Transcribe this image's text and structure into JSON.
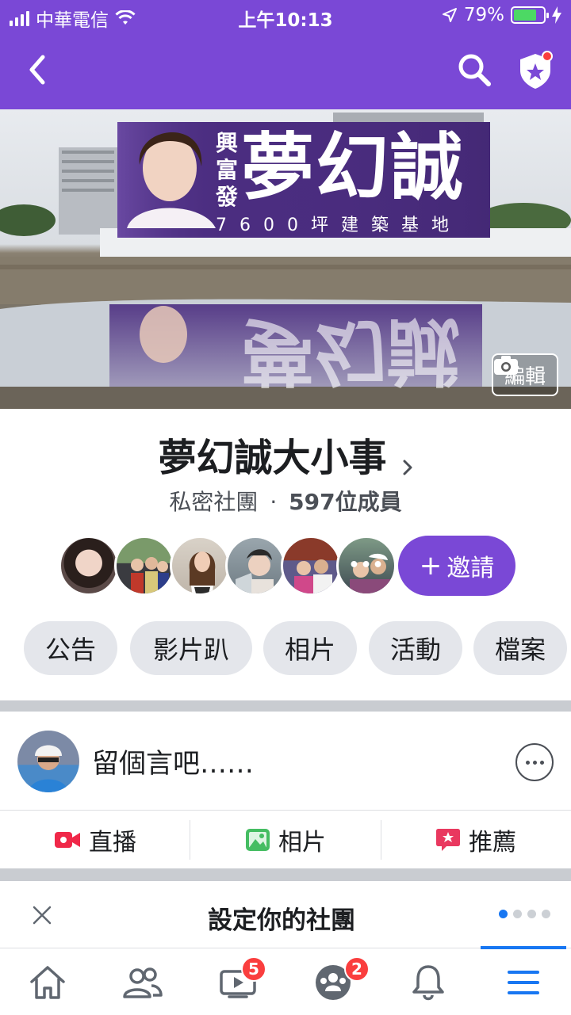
{
  "status_bar": {
    "carrier": "中華電信",
    "time": "上午10:13",
    "battery": "79%",
    "battery_level": 0.79
  },
  "nav": {
    "back_icon": "chevron-left-icon",
    "search_icon": "search-icon",
    "shield_icon": "admin-shield-icon"
  },
  "cover": {
    "billboard_small": "興富發",
    "billboard_title": "夢幻誠",
    "billboard_subtitle": "7600坪建築基地",
    "edit_label": "編輯"
  },
  "group": {
    "name": "夢幻誠大小事",
    "privacy": "私密社團",
    "separator": "·",
    "members_count": "597位成員",
    "more_members": "•••",
    "invite_label": "邀請"
  },
  "chips": [
    "公告",
    "影片趴",
    "相片",
    "活動",
    "檔案"
  ],
  "composer": {
    "placeholder": "留個言吧……"
  },
  "post_actions": [
    {
      "label": "直播",
      "icon": "live-video-icon"
    },
    {
      "label": "相片",
      "icon": "photo-icon"
    },
    {
      "label": "推薦",
      "icon": "recommend-icon"
    }
  ],
  "setup": {
    "title": "設定你的社團",
    "pages": 4,
    "current_page": 1
  },
  "tabs": [
    {
      "name": "home",
      "icon": "home-icon",
      "badge": ""
    },
    {
      "name": "friends",
      "icon": "friends-icon",
      "badge": ""
    },
    {
      "name": "watch",
      "icon": "watch-icon",
      "badge": "5"
    },
    {
      "name": "groups",
      "icon": "groups-icon",
      "badge": "2"
    },
    {
      "name": "notifications",
      "icon": "bell-icon",
      "badge": ""
    },
    {
      "name": "menu",
      "icon": "menu-icon",
      "badge": ""
    }
  ],
  "colors": {
    "brand_purple": "#7a48d6",
    "active_blue": "#1877f2",
    "badge_red": "#fa3e3e"
  }
}
